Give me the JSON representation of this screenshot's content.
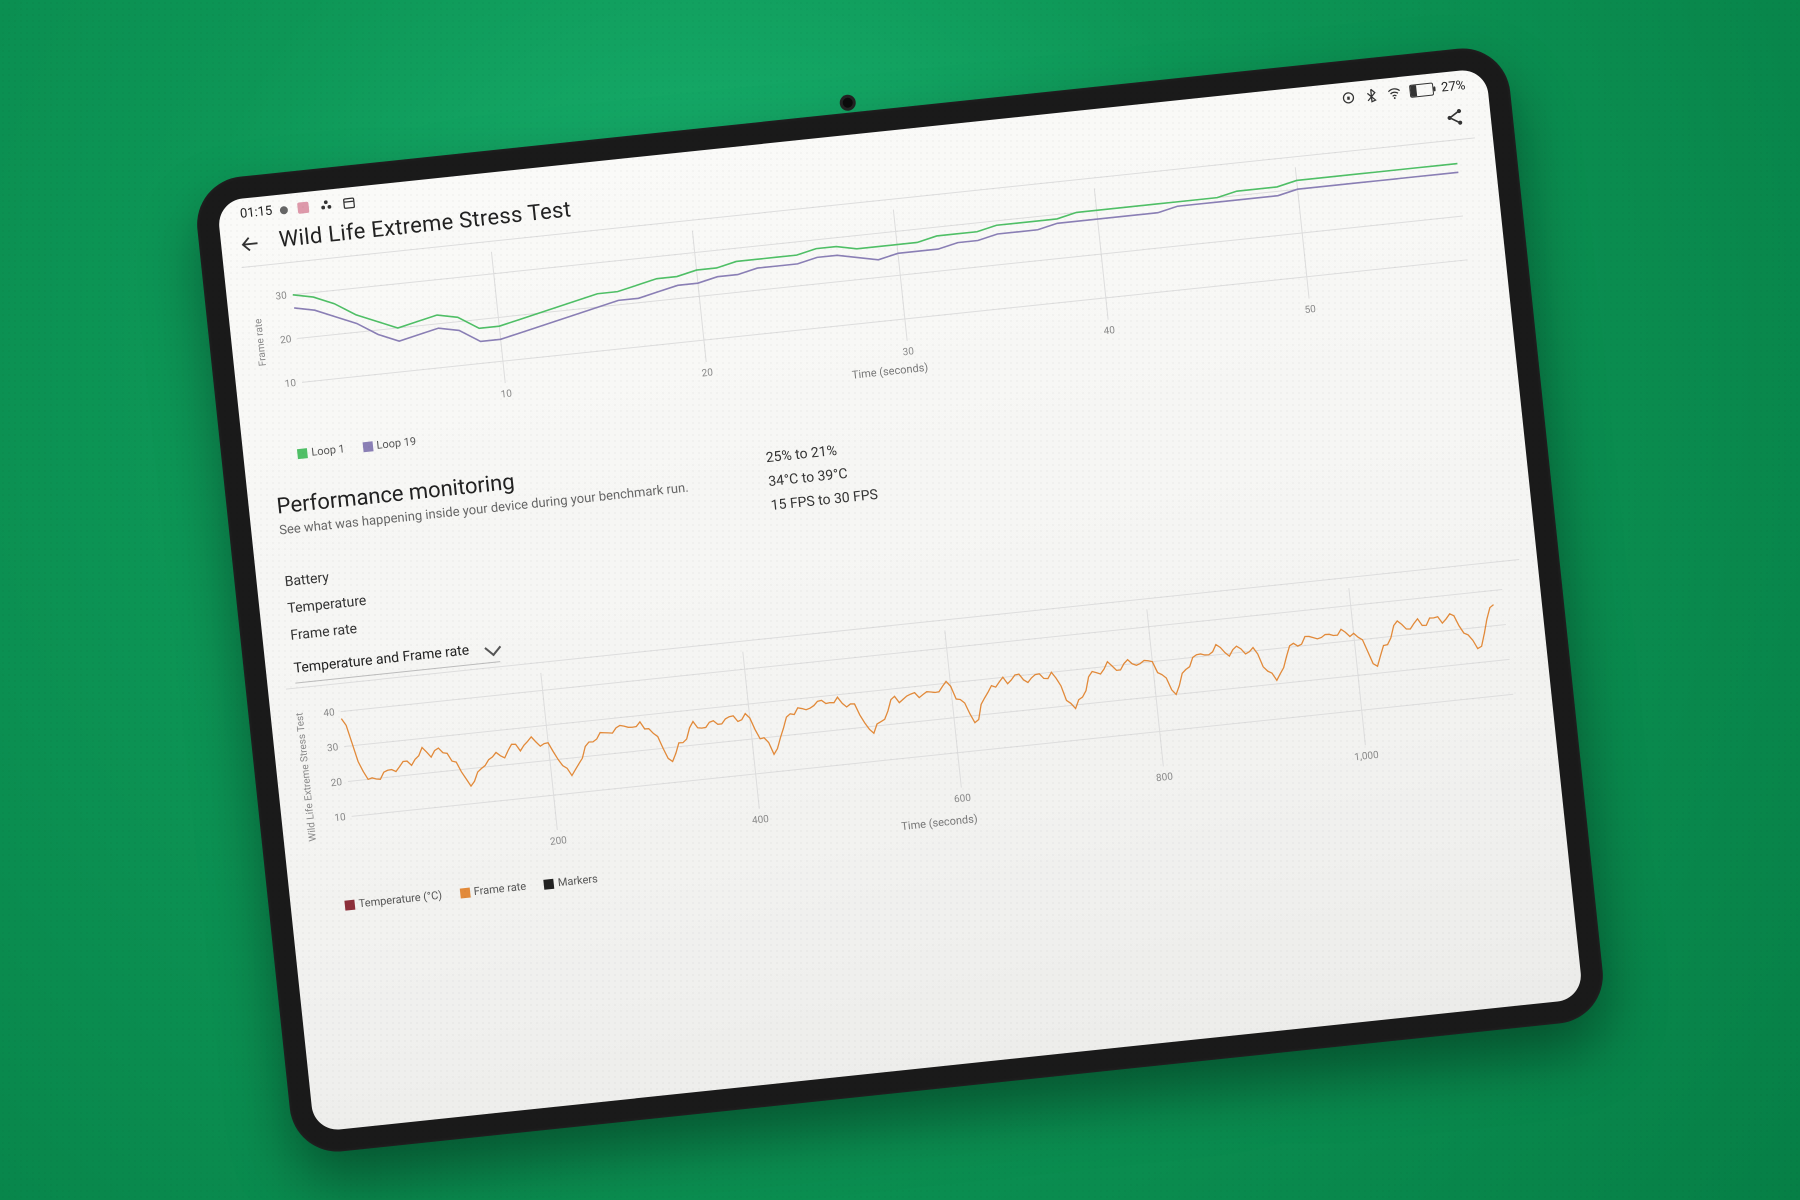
{
  "statusbar": {
    "time": "01:15",
    "battery_percent": "27%"
  },
  "header": {
    "title": "Wild Life Extreme Stress Test"
  },
  "chart_data": [
    {
      "type": "line",
      "title": "",
      "xlabel": "Time (seconds)",
      "ylabel": "Frame rate",
      "x_ticks": [
        10,
        20,
        30,
        40,
        50
      ],
      "y_ticks": [
        10,
        20,
        30
      ],
      "xlim": [
        0,
        58
      ],
      "ylim": [
        5,
        35
      ],
      "series": [
        {
          "name": "Loop 1",
          "color": "#4fbf66",
          "x": [
            0,
            1,
            2,
            3,
            4,
            5,
            6,
            7,
            8,
            9,
            10,
            11,
            12,
            13,
            14,
            15,
            16,
            17,
            18,
            19,
            20,
            21,
            22,
            23,
            24,
            25,
            26,
            27,
            28,
            29,
            30,
            31,
            32,
            33,
            34,
            35,
            36,
            37,
            38,
            39,
            40,
            41,
            42,
            43,
            44,
            45,
            46,
            47,
            48,
            49,
            50,
            51,
            52,
            53,
            54,
            55,
            56,
            57,
            58
          ],
          "y": [
            30,
            29,
            27,
            24,
            22,
            20,
            21,
            22,
            21,
            18,
            18,
            19,
            20,
            21,
            22,
            23,
            23,
            24,
            25,
            25,
            26,
            26,
            27,
            27,
            27,
            27,
            28,
            28,
            27,
            27,
            27,
            27,
            28,
            28,
            28,
            29,
            29,
            29,
            29,
            30,
            30,
            30,
            30,
            30,
            30,
            30,
            30,
            31,
            31,
            31,
            32,
            32,
            32,
            32,
            32,
            32,
            32,
            32,
            32
          ]
        },
        {
          "name": "Loop 19",
          "color": "#8a7fb5",
          "x": [
            0,
            1,
            2,
            3,
            4,
            5,
            6,
            7,
            8,
            9,
            10,
            11,
            12,
            13,
            14,
            15,
            16,
            17,
            18,
            19,
            20,
            21,
            22,
            23,
            24,
            25,
            26,
            27,
            28,
            29,
            30,
            31,
            32,
            33,
            34,
            35,
            36,
            37,
            38,
            39,
            40,
            41,
            42,
            43,
            44,
            45,
            46,
            47,
            48,
            49,
            50,
            51,
            52,
            53,
            54,
            55,
            56,
            57,
            58
          ],
          "y": [
            27,
            26,
            24,
            22,
            19,
            17,
            18,
            19,
            18,
            15,
            15,
            16,
            17,
            18,
            19,
            20,
            21,
            21,
            22,
            23,
            23,
            24,
            24,
            25,
            25,
            25,
            26,
            26,
            25,
            24,
            25,
            25,
            25,
            26,
            26,
            27,
            27,
            27,
            28,
            28,
            28,
            28,
            28,
            28,
            29,
            29,
            29,
            29,
            29,
            29,
            30,
            30,
            30,
            30,
            30,
            30,
            30,
            30,
            30
          ]
        }
      ],
      "legend": [
        "Loop 1",
        "Loop 19"
      ]
    },
    {
      "type": "line",
      "title": "",
      "xlabel": "Time (seconds)",
      "ylabel": "Wild Life Extreme Stress Test",
      "x_ticks": [
        200,
        400,
        600,
        800,
        1000
      ],
      "y_ticks": [
        10,
        20,
        30,
        40
      ],
      "xlim": [
        0,
        1150
      ],
      "ylim": [
        0,
        45
      ],
      "series": [
        {
          "name": "Frame rate",
          "color": "#e28a3a",
          "x": [
            0,
            20,
            40,
            60,
            80,
            100,
            120,
            140,
            160,
            180,
            200,
            220,
            240,
            260,
            280,
            300,
            320,
            340,
            360,
            380,
            400,
            420,
            440,
            460,
            480,
            500,
            520,
            540,
            560,
            580,
            600,
            620,
            640,
            660,
            680,
            700,
            720,
            740,
            760,
            780,
            800,
            820,
            840,
            860,
            880,
            900,
            920,
            940,
            960,
            980,
            1000,
            1020,
            1040,
            1060,
            1080,
            1100,
            1120,
            1140
          ],
          "y": [
            38,
            20,
            22,
            24,
            26,
            25,
            15,
            22,
            24,
            26,
            25,
            15,
            24,
            26,
            27,
            26,
            16,
            25,
            26,
            27,
            26,
            15,
            26,
            27,
            28,
            27,
            18,
            27,
            28,
            28,
            29,
            18,
            28,
            29,
            29,
            30,
            19,
            29,
            30,
            30,
            30,
            20,
            30,
            31,
            31,
            31,
            21,
            31,
            32,
            32,
            32,
            22,
            33,
            33,
            34,
            34,
            24,
            36
          ]
        }
      ],
      "legend": [
        "Temperature (°C)",
        "Frame rate",
        "Markers"
      ]
    }
  ],
  "perf": {
    "title": "Performance monitoring",
    "subtitle": "See what was happening inside your device during your benchmark run.",
    "metrics": {
      "battery": {
        "label": "Battery",
        "value": "25% to 21%"
      },
      "temperature": {
        "label": "Temperature",
        "value": "34°C to 39°C"
      },
      "framerate": {
        "label": "Frame rate",
        "value": "15 FPS to 30 FPS"
      }
    },
    "dropdown": "Temperature and Frame rate"
  },
  "legend_colors": {
    "loop1": "#4fbf66",
    "loop19": "#8a7fb5",
    "temperature": "#8c2f3a",
    "framerate": "#e28a3a",
    "markers": "#222222"
  }
}
